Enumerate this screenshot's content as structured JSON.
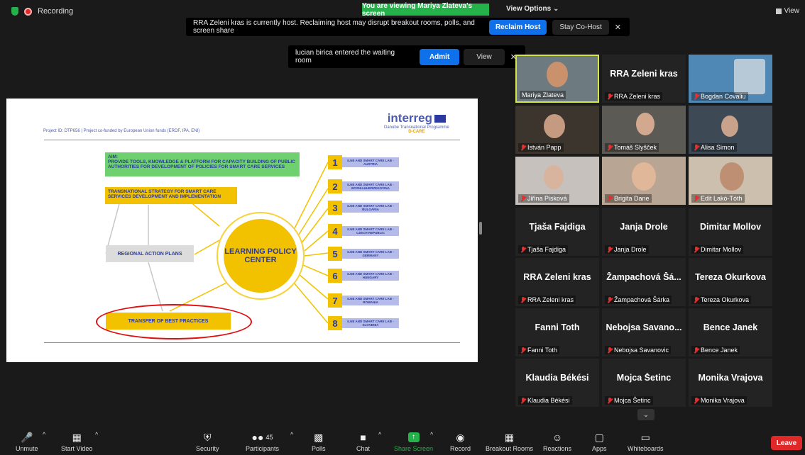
{
  "status": {
    "recording": "Recording",
    "viewing": "You are viewing Mariya Zlateva's screen",
    "view_options": "View Options ⌄",
    "view_top": "View"
  },
  "host_banner": {
    "message": "RRA Zeleni kras is currently host. Reclaiming host may disrupt breakout rooms, polls, and screen share",
    "reclaim": "Reclaim Host",
    "stay": "Stay Co-Host",
    "close": "✕"
  },
  "waiting": {
    "message": "lucian birica entered the waiting room",
    "admit": "Admit",
    "view": "View",
    "close": "✕"
  },
  "slide": {
    "project_id": "Project ID: DTP656 | Project co-funded by European Union funds (ERDF, IPA, ENI)",
    "logo_name": "interreg",
    "logo_sub": "Danube Transnational Programme",
    "logo_sub2": "D-CARE",
    "aim": "AIM:\nPROVIDE TOOLS, KNOWLEDGE & PLATFORM FOR CAPACITY BUILDING OF PUBLIC AUTHORITIES FOR DEVELOPMENT OF POLICIES FOR SMART CARE SERVICES",
    "strategy": "TRANSNATIONAL STRATEGY FOR SMART CARE SERVICES DEVELOPMENT AND IMPLEMENTATION",
    "regional": "REGIONAL ACTION PLANS",
    "transfer": "TRANSFER OF BEST PRACTICES",
    "center": "LEARNING POLICY CENTER",
    "labs": [
      {
        "num": "1",
        "text": "ILNE AND SMART CARE LAB - AUSTRIA"
      },
      {
        "num": "2",
        "text": "ILNE AND SMART CARE LAB - BOSNIA&HERZEGOVINA"
      },
      {
        "num": "3",
        "text": "ILNE AND SMART CARE LAB - BULGARIA"
      },
      {
        "num": "4",
        "text": "ILNE AND SMART CARE LAB - CZECH REPUBLIC"
      },
      {
        "num": "5",
        "text": "ILNE AND SMART CARE LAB - GERMANY"
      },
      {
        "num": "6",
        "text": "ILNE AND SMART CARE LAB - HUNGARY"
      },
      {
        "num": "7",
        "text": "ILNE AND SMART CARE LAB - ROMANIA"
      },
      {
        "num": "8",
        "text": "ILNE AND SMART CARE LAB - SLOVENIA"
      }
    ]
  },
  "participants": [
    {
      "display": "",
      "label": "Mariya Zlateva",
      "video": true,
      "muted": false
    },
    {
      "display": "RRA Zeleni kras",
      "label": "RRA Zeleni kras",
      "video": false,
      "muted": true
    },
    {
      "display": "",
      "label": "Bogdan Covaliu",
      "video": true,
      "muted": true
    },
    {
      "display": "",
      "label": "István Papp",
      "video": true,
      "muted": true
    },
    {
      "display": "",
      "label": "Tomáš Slyšček",
      "video": true,
      "muted": true
    },
    {
      "display": "",
      "label": "Alisa Simon",
      "video": true,
      "muted": true
    },
    {
      "display": "",
      "label": "Jiřina Pisková",
      "video": true,
      "muted": true
    },
    {
      "display": "",
      "label": "Brigita Dane",
      "video": true,
      "muted": true
    },
    {
      "display": "",
      "label": "Edit Lakó-Tóth",
      "video": true,
      "muted": true
    },
    {
      "display": "Tjaša Fajdiga",
      "label": "Tjaša Fajdiga",
      "video": false,
      "muted": true
    },
    {
      "display": "Janja Drole",
      "label": "Janja Drole",
      "video": false,
      "muted": true
    },
    {
      "display": "Dimitar Mollov",
      "label": "Dimitar Mollov",
      "video": false,
      "muted": true
    },
    {
      "display": "RRA Zeleni kras",
      "label": "RRA Zeleni kras",
      "video": false,
      "muted": true
    },
    {
      "display": "Žampachová Šá...",
      "label": "Žampachová Šárka",
      "video": false,
      "muted": true
    },
    {
      "display": "Tereza Okurkova",
      "label": "Tereza Okurkova",
      "video": false,
      "muted": true
    },
    {
      "display": "Fanni Toth",
      "label": "Fanni Toth",
      "video": false,
      "muted": true
    },
    {
      "display": "Nebojsa Savano...",
      "label": "Nebojsa Savanovic",
      "video": false,
      "muted": true
    },
    {
      "display": "Bence Janek",
      "label": "Bence Janek",
      "video": false,
      "muted": true
    },
    {
      "display": "Klaudia Békési",
      "label": "Klaudia Békési",
      "video": false,
      "muted": true
    },
    {
      "display": "Mojca Šetinc",
      "label": "Mojca Šetinc",
      "video": false,
      "muted": true
    },
    {
      "display": "Monika Vrajova",
      "label": "Monika Vrajova",
      "video": false,
      "muted": true
    }
  ],
  "more_icon": "⌄",
  "toolbar": {
    "unmute": "Unmute",
    "start_video": "Start Video",
    "security": "Security",
    "participants": "Participants",
    "participants_count": "45",
    "polls": "Polls",
    "chat": "Chat",
    "share": "Share Screen",
    "record": "Record",
    "breakout": "Breakout Rooms",
    "reactions": "Reactions",
    "apps": "Apps",
    "whiteboards": "Whiteboards",
    "leave": "Leave",
    "caret": "^"
  }
}
